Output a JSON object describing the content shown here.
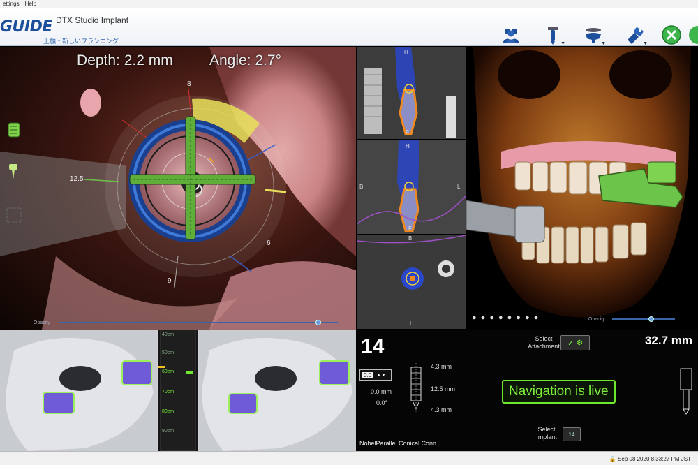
{
  "menu": {
    "items": [
      "ettings",
      "Help"
    ]
  },
  "header": {
    "logo": "GUIDE",
    "app_title": "DTX Studio Implant",
    "plan_name": "上顎・新しいプランニング"
  },
  "toolbar": {
    "icons": [
      "users-icon",
      "drill-icon",
      "handpiece-icon",
      "camera-icon",
      "navigation-start-icon",
      "help-icon"
    ],
    "accent": "#1d4f9c",
    "nav_green": "#3db54a"
  },
  "nav_view": {
    "depth_label": "Depth: 2.2 mm",
    "angle_label": "Angle: 2.7°",
    "tick_labels": [
      "8",
      "12.5",
      "9",
      "6"
    ],
    "opacity_label": "Opacity",
    "opacity_value": 0.93
  },
  "ct_view": {
    "labels": {
      "h1": "H",
      "f1": "F",
      "h2": "H",
      "b2": "B",
      "l2": "L",
      "f2": "F",
      "b3": "B",
      "l3": "L"
    }
  },
  "skull_view": {
    "opacity_label": "Opacity",
    "opacity_value": 0.62
  },
  "camera_view": {
    "scale_labels": [
      "40cm",
      "50cm",
      "60cm",
      "70cm",
      "80cm",
      "90cm"
    ]
  },
  "info": {
    "tooth_number": "14",
    "depth_value": "32.7 mm",
    "select_attachment": "Select Attachment",
    "select_implant": "Select Implant",
    "implant_badge": "14",
    "nav_status": "Navigation is live",
    "dim_top": "4.3 mm",
    "dim_length": "12.5 mm",
    "dim_bottom": "4.3 mm",
    "offset": "0.0 mm",
    "angle": "0.0°",
    "step_value": "0.0",
    "implant_name": "NobelParallel Conical Conn..."
  },
  "status": {
    "clock": "Sep 08 2020 8:33:27 PM JST"
  }
}
